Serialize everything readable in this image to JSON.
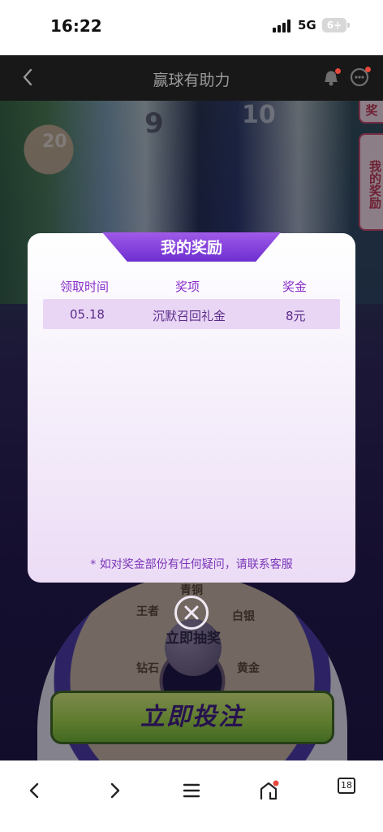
{
  "status_bar": {
    "time": "16:22",
    "network": "5G",
    "battery": "6+"
  },
  "header": {
    "title": "赢球有助力",
    "back_icon": "chevron-left-icon",
    "bell_icon": "bell-icon",
    "chat_icon": "chat-icon"
  },
  "background": {
    "jerseys": [
      "20",
      "9",
      "10"
    ],
    "side_tabs": [
      "奖",
      "我的奖励"
    ],
    "wheel_labels": [
      "青铜",
      "白银",
      "黄金",
      "王者",
      "钻石"
    ],
    "draw_button": "立即抽奖",
    "bet_button": "立即投注"
  },
  "modal": {
    "title": "我的奖励",
    "columns": [
      "领取时间",
      "奖项",
      "奖金"
    ],
    "rows": [
      {
        "time": "05.18",
        "prize": "沉默召回礼金",
        "amount": "8元"
      }
    ],
    "note": "* 如对奖金部份有任何疑问，请联系客服",
    "close_icon": "close-icon"
  },
  "bottom_nav": {
    "tab_count": "18",
    "icons": [
      "back-icon",
      "forward-icon",
      "menu-icon",
      "home-icon",
      "tabs-icon"
    ]
  }
}
